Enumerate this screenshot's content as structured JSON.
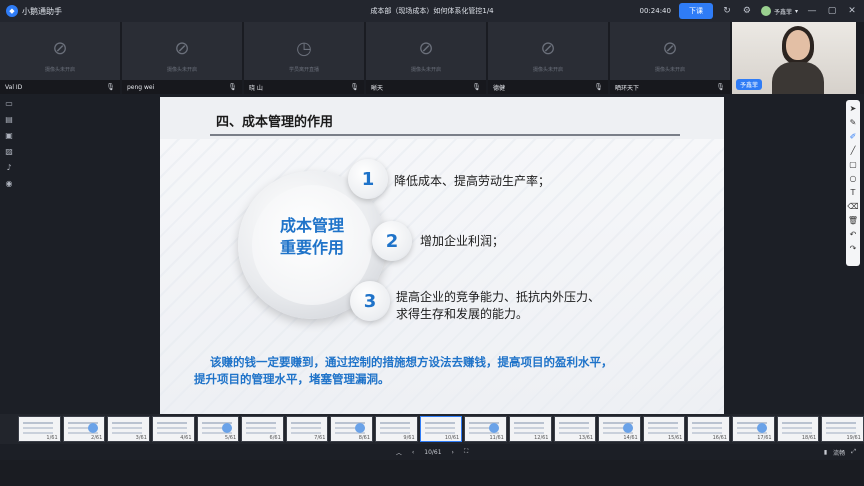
{
  "titlebar": {
    "app_name": "小鹅通助手",
    "doc_title": "成本部（现场成本）如何体系化管控1/4",
    "timer": "00:24:40",
    "leave_label": "下课",
    "user_name": "予鑫菲"
  },
  "video_tiles": [
    {
      "name": "Val ID",
      "cam_text": "摄像头未开启"
    },
    {
      "name": "peng wei",
      "cam_text": "摄像头未开启"
    },
    {
      "name": "晓 山",
      "cam_text": "学员离开直播"
    },
    {
      "name": "晰天",
      "cam_text": "摄像头未开启"
    },
    {
      "name": "德健",
      "cam_text": "摄像头未开启"
    },
    {
      "name": "晒环天下",
      "cam_text": "摄像头未开启"
    }
  ],
  "live_tile": {
    "badge": "予鑫菲"
  },
  "slide": {
    "heading": "四、成本管理的作用",
    "circle_line1": "成本管理",
    "circle_line2": "重要作用",
    "points": [
      {
        "num": "1",
        "text": "降低成本、提高劳动生产率；"
      },
      {
        "num": "2",
        "text": "增加企业利润；"
      },
      {
        "num": "3",
        "line1": "提高企业的竞争能力、抵抗内外压力、",
        "line2": "求得生存和发展的能力。"
      }
    ],
    "footnote_line1": "该赚的钱一定要赚到，通过控制的措施想方设法去赚钱，提高项目的盈利水平，",
    "footnote_line2": "提升项目的管理水平，堵塞管理漏洞。"
  },
  "thumbnails": [
    "1/61",
    "2/61",
    "3/61",
    "4/61",
    "5/61",
    "6/61",
    "7/61",
    "8/61",
    "9/61",
    "10/61",
    "11/61",
    "12/61",
    "13/61",
    "14/61",
    "15/61",
    "16/61",
    "17/61",
    "18/61",
    "19/61"
  ],
  "active_thumb": "10/61",
  "bottom_bar": {
    "page_indicator": "10/61",
    "quality_label": "流畅"
  }
}
